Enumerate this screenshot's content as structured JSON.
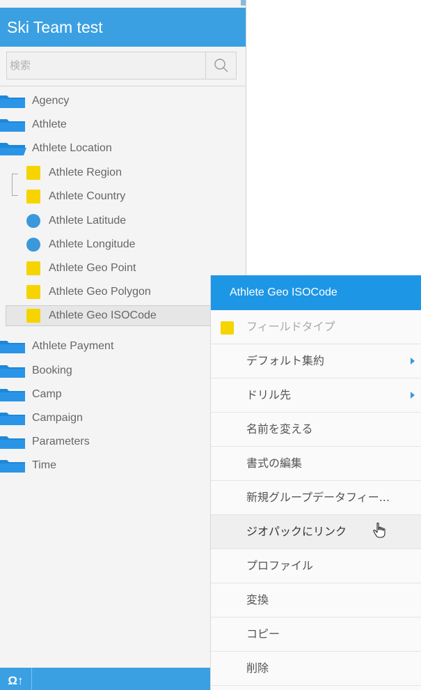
{
  "panel": {
    "title": "Ski Team test",
    "search_placeholder": "検索",
    "icons": {
      "search": "search-icon",
      "folder": "folder-icon",
      "sort": "sort-icon"
    },
    "colors": {
      "header": "#3aa0e2",
      "dimension": "#f5d400",
      "metric": "#3b98db"
    },
    "folders_top": [
      {
        "label": "Agency"
      },
      {
        "label": "Athlete"
      },
      {
        "label": "Athlete Location",
        "open": true
      }
    ],
    "fields": [
      {
        "label": "Athlete Region",
        "type": "dimension"
      },
      {
        "label": "Athlete Country",
        "type": "dimension"
      },
      {
        "label": "Athlete Latitude",
        "type": "metric"
      },
      {
        "label": "Athlete Longitude",
        "type": "metric"
      },
      {
        "label": "Athlete Geo Point",
        "type": "dimension"
      },
      {
        "label": "Athlete Geo Polygon",
        "type": "dimension"
      },
      {
        "label": "Athlete Geo ISOCode",
        "type": "dimension",
        "selected": true
      }
    ],
    "folders_bottom": [
      {
        "label": "Athlete Payment"
      },
      {
        "label": "Booking"
      },
      {
        "label": "Camp"
      },
      {
        "label": "Campaign"
      },
      {
        "label": "Parameters"
      },
      {
        "label": "Time"
      }
    ],
    "footer_label": "Ω↑"
  },
  "context_menu": {
    "title": "Athlete Geo ISOCode",
    "items": [
      {
        "label": "フィールドタイプ",
        "disabled": true,
        "type_icon": true
      },
      {
        "label": "デフォルト集約",
        "submenu": true
      },
      {
        "label": "ドリル先",
        "submenu": true
      },
      {
        "label": "名前を変える"
      },
      {
        "label": "書式の編集"
      },
      {
        "label": "新規グループデータフィー..."
      },
      {
        "label": "ジオパックにリンク",
        "hover": true
      },
      {
        "label": "プロファイル"
      },
      {
        "label": "変換"
      },
      {
        "label": "コピー"
      },
      {
        "label": "削除"
      }
    ]
  }
}
